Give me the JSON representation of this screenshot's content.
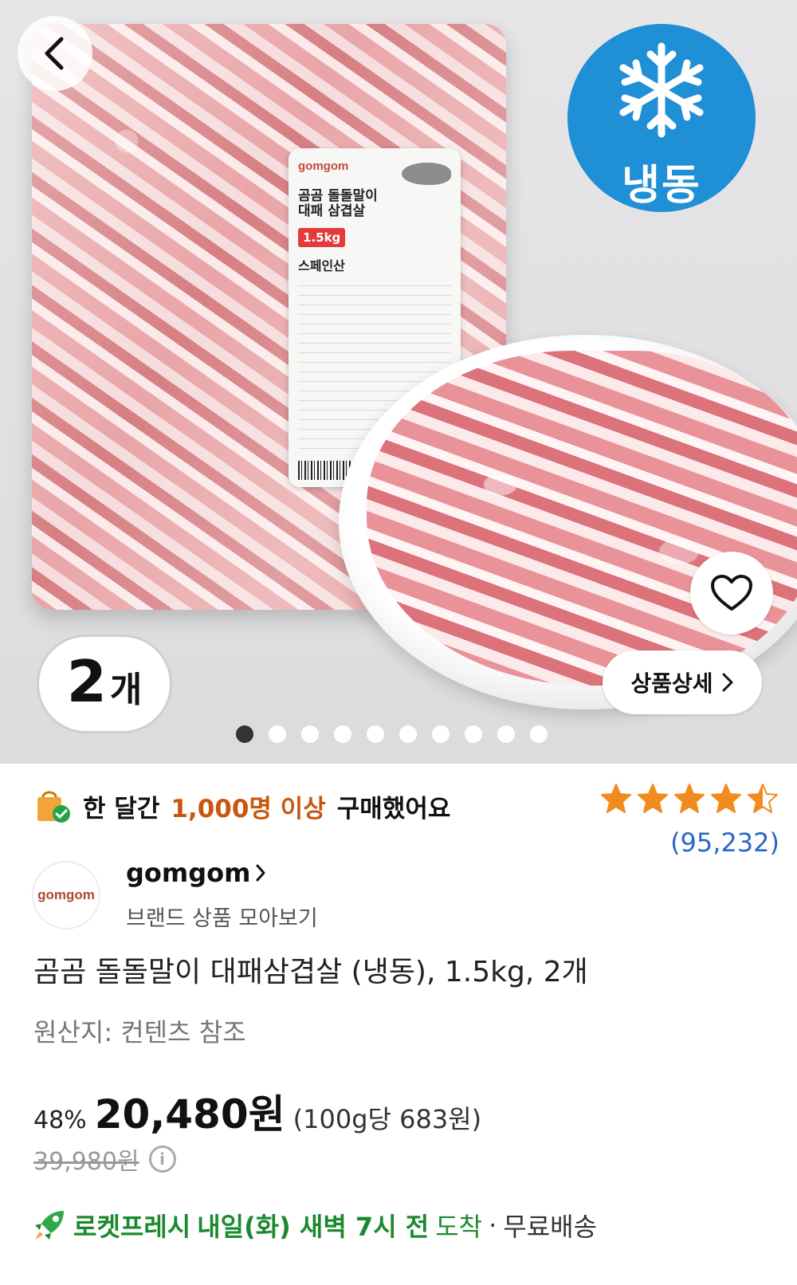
{
  "hero": {
    "label_logo": "gomgom",
    "label_title_1": "곰곰 돌돌말이",
    "label_title_2": "대패 삼겹살",
    "label_weight": "1.5kg",
    "label_origin": "스페인산",
    "frozen_badge": "냉동",
    "quantity_number": "2",
    "quantity_unit": "개",
    "detail_button": "상품상세",
    "carousel": {
      "count": 10,
      "active": 0
    }
  },
  "purchase_notice": {
    "prefix": "한 달간",
    "highlight": "1,000명 이상",
    "suffix": "구매했어요"
  },
  "rating": {
    "stars": 4.5,
    "review_count": "(95,232)",
    "star_color": "#f28b1f"
  },
  "brand": {
    "logo_text": "gomgom",
    "name": "gomgom",
    "sub": "브랜드 상품 모아보기"
  },
  "product": {
    "title": "곰곰 돌돌말이 대패삼겹살 (냉동), 1.5kg, 2개",
    "origin": "원산지: 컨텐츠 참조"
  },
  "price": {
    "discount": "48%",
    "sale": "20,480원",
    "unit": "(100g당 683원)",
    "original": "39,980원"
  },
  "delivery": {
    "service": "로켓프레시",
    "when": "내일(화) 새벽 7시 전",
    "arrive": "도착",
    "separator": "·",
    "shipping": "무료배송"
  },
  "colors": {
    "frozen_blue": "#1f8fd6",
    "highlight_orange": "#c8560e",
    "review_blue": "#2a66c9",
    "rocket_green": "#1b8a2f"
  }
}
